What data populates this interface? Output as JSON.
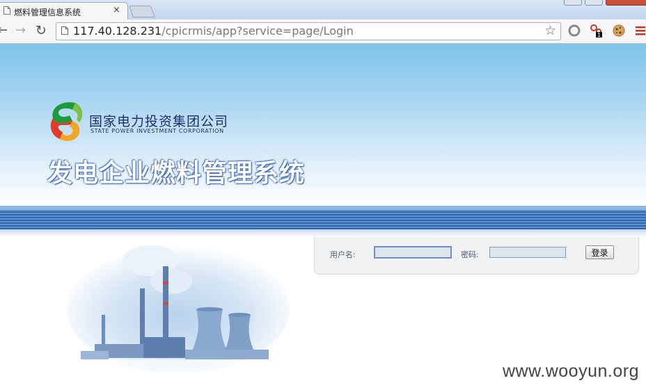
{
  "browser": {
    "tab_title": "燃料管理信息系统",
    "tab_close": "×",
    "url_host": "117.40.128.231",
    "url_path": "/cpicrmis/app?service=page/Login",
    "extension_badge": "1"
  },
  "header": {
    "company_cn": "国家电力投资集团公司",
    "company_en": "STATE POWER INVESTMENT CORPORATION",
    "system_title": "发电企业燃料管理系统"
  },
  "login": {
    "username_label": "用户名:",
    "username_value": "",
    "password_label": "密码:",
    "password_value": "",
    "submit_label": "登录"
  },
  "watermark": "www.wooyun.org",
  "colors": {
    "banner_top": "#7ec2ea",
    "stripe": "#2e69b0",
    "title_text": "#1d2f6e"
  }
}
